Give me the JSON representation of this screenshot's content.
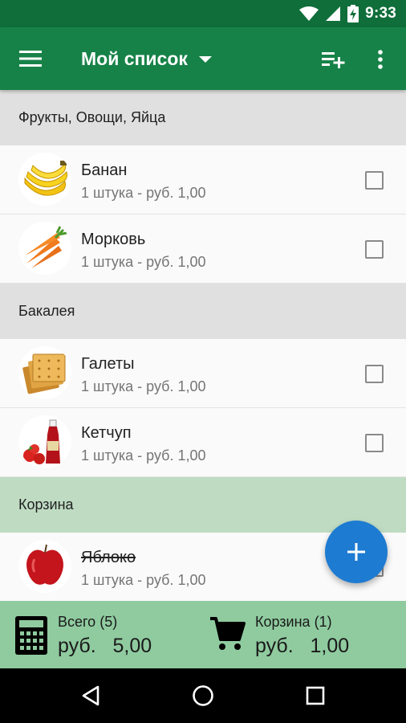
{
  "status_bar": {
    "time": "9:33",
    "icons": [
      "wifi-icon",
      "signal-icon",
      "battery-charging-icon"
    ]
  },
  "app_bar": {
    "title": "Мой список",
    "menu_icon": "menu-icon",
    "add_list_icon": "playlist-add-icon",
    "more_icon": "more-vert-icon"
  },
  "sections": [
    {
      "title": "Фрукты, Овощи, Яйца",
      "kind": "category",
      "items": [
        {
          "name": "Банан",
          "detail": "1 штука - руб. 1,00",
          "image": "banana",
          "checked": false
        },
        {
          "name": "Морковь",
          "detail": "1 штука - руб. 1,00",
          "image": "carrot",
          "checked": false
        }
      ]
    },
    {
      "title": "Бакалея",
      "kind": "category",
      "items": [
        {
          "name": "Галеты",
          "detail": "1 штука - руб. 1,00",
          "image": "crackers",
          "checked": false
        },
        {
          "name": "Кетчуп",
          "detail": "1 штука - руб. 1,00",
          "image": "ketchup",
          "checked": false
        }
      ]
    },
    {
      "title": "Корзина",
      "kind": "cart",
      "items": [
        {
          "name": "Яблоко",
          "detail": "1 штука - руб. 1,00",
          "image": "apple",
          "checked": true
        }
      ]
    }
  ],
  "fab": {
    "icon": "add-icon"
  },
  "totals": {
    "total_label": "Всего (5)",
    "total_value": "руб.   5,00",
    "cart_label": "Корзина (1)",
    "cart_value": "руб.   1,00"
  },
  "colors": {
    "status_bar": "#0f6e3a",
    "app_bar": "#178248",
    "fab": "#1e7bd2",
    "cart_header": "#bfdcc3",
    "bottom_bar": "#8fcb9f"
  },
  "nav": [
    "back-icon",
    "home-icon",
    "recents-icon"
  ]
}
